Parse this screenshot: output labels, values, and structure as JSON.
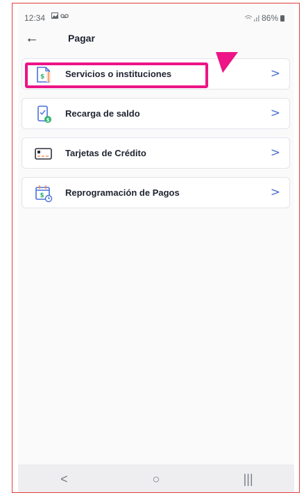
{
  "status_bar": {
    "time": "12:34",
    "indicators": [
      "gallery-icon",
      "voicemail-icon"
    ],
    "signal": "wifi-signal-icon",
    "battery_text": "86%"
  },
  "header": {
    "title": "Pagar",
    "back_icon": "arrow-left-icon"
  },
  "menu": {
    "items": [
      {
        "label": "Servicios o instituciones",
        "icon": "bill-icon"
      },
      {
        "label": "Recarga de saldo",
        "icon": "phone-recharge-icon"
      },
      {
        "label": "Tarjetas de Crédito",
        "icon": "credit-card-icon"
      },
      {
        "label": "Reprogramación de Pagos",
        "icon": "calendar-payment-icon"
      }
    ],
    "chevron": ">"
  },
  "annotation": {
    "highlight_color": "#ec1486",
    "highlighted_item": "Servicios o instituciones"
  },
  "nav_bar": {
    "back": "<",
    "home": "○",
    "recents": "|||"
  },
  "colors": {
    "icon_blue": "#4b6fd8",
    "icon_orange": "#f28b50",
    "icon_green": "#2fb36f",
    "frame_border": "#e23b3b"
  }
}
